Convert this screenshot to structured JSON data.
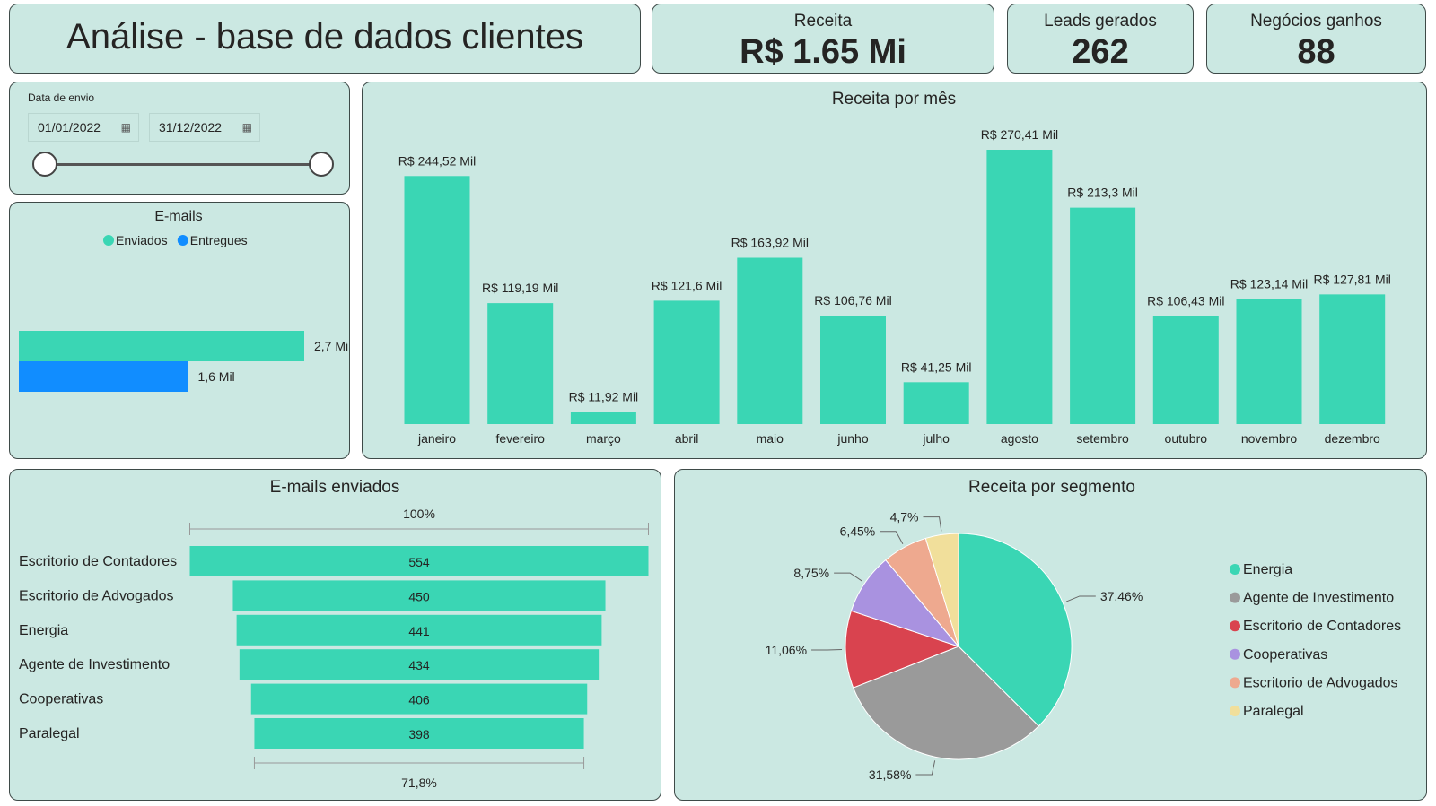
{
  "header": {
    "title": "Análise - base de dados clientes"
  },
  "kpis": [
    {
      "label": "Receita",
      "value": "R$ 1.65 Mi"
    },
    {
      "label": "Leads gerados",
      "value": "262"
    },
    {
      "label": "Negócios ganhos",
      "value": "88"
    }
  ],
  "slicer": {
    "title": "Data de envio",
    "start": "01/01/2022",
    "end": "31/12/2022",
    "calendar_icon": "calendar-icon"
  },
  "colors": {
    "teal": "#3ad6b4",
    "blue": "#118dff",
    "panel_bg": "#cbe8e2"
  },
  "chart_data": [
    {
      "id": "emails",
      "type": "bar",
      "title": "E-mails",
      "orientation": "horizontal",
      "legend_position": "top-center",
      "series": [
        {
          "name": "Enviados",
          "value": 2700,
          "label": "2,7 Mil",
          "color": "#3ad6b4"
        },
        {
          "name": "Entregues",
          "value": 1600,
          "label": "1,6 Mil",
          "color": "#118dff"
        }
      ],
      "xlim": [
        0,
        2700
      ]
    },
    {
      "id": "receita_mes",
      "type": "bar",
      "title": "Receita por mês",
      "categories": [
        "janeiro",
        "fevereiro",
        "março",
        "abril",
        "maio",
        "junho",
        "julho",
        "agosto",
        "setembro",
        "outubro",
        "novembro",
        "dezembro"
      ],
      "values": [
        244.52,
        119.19,
        11.92,
        121.6,
        163.92,
        106.76,
        41.25,
        270.41,
        213.3,
        106.43,
        123.14,
        127.81
      ],
      "labels": [
        "R$ 244,52 Mil",
        "R$ 119,19 Mil",
        "R$ 11,92 Mil",
        "R$ 121,6 Mil",
        "R$ 163,92 Mil",
        "R$ 106,76 Mil",
        "R$ 41,25 Mil",
        "R$ 270,41 Mil",
        "R$ 213,3 Mil",
        "R$ 106,43 Mil",
        "R$ 123,14 Mil",
        "R$ 127,81 Mil"
      ],
      "ylim": [
        0,
        270.41
      ]
    },
    {
      "id": "emails_enviados",
      "type": "bar",
      "subtype": "funnel",
      "title": "E-mails enviados",
      "categories": [
        "Escritorio de Contadores",
        "Escritorio de Advogados",
        "Energia",
        "Agente de Investimento",
        "Cooperativas",
        "Paralegal"
      ],
      "values": [
        554,
        450,
        441,
        434,
        406,
        398
      ],
      "top_label": "100%",
      "bottom_label": "71,8%"
    },
    {
      "id": "receita_segmento",
      "type": "pie",
      "title": "Receita por segmento",
      "legend_position": "right",
      "slices": [
        {
          "name": "Energia",
          "value": 37.46,
          "label": "37,46%",
          "color": "#3ad6b4"
        },
        {
          "name": "Agente de Investimento",
          "value": 31.58,
          "label": "31,58%",
          "color": "#9a9a9a"
        },
        {
          "name": "Escritorio de Contadores",
          "value": 11.06,
          "label": "11,06%",
          "color": "#d9434f"
        },
        {
          "name": "Cooperativas",
          "value": 8.75,
          "label": "8,75%",
          "color": "#a992e0"
        },
        {
          "name": "Escritorio de Advogados",
          "value": 6.45,
          "label": "6,45%",
          "color": "#eea98f"
        },
        {
          "name": "Paralegal",
          "value": 4.7,
          "label": "4,7%",
          "color": "#f1df9b"
        }
      ]
    }
  ]
}
